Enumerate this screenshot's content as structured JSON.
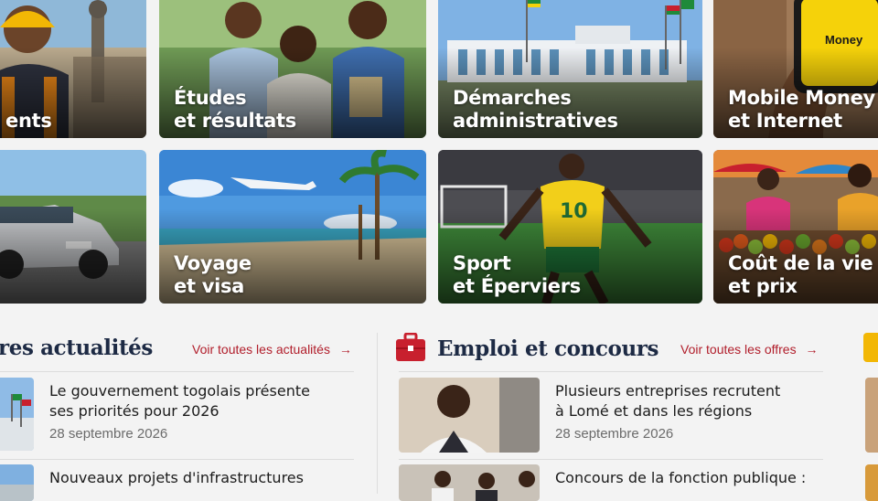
{
  "tiles": [
    {
      "line1": "",
      "line2": "ents"
    },
    {
      "line1": "Études",
      "line2": "et résultats"
    },
    {
      "line1": "Démarches",
      "line2": "administratives"
    },
    {
      "line1": "Mobile Money",
      "line2": "et Internet"
    },
    {
      "line1": "",
      "line2": ""
    },
    {
      "line1": "Voyage",
      "line2": "et visa"
    },
    {
      "line1": "Sport",
      "line2": "et Éperviers"
    },
    {
      "line1": "Coût de la vie",
      "line2": "et prix"
    }
  ],
  "phone_brand": "Money",
  "jersey_number": "10",
  "news": {
    "title": "res actualités",
    "link": "Voir toutes les actualités",
    "items": [
      {
        "line1": "Le gouvernement togolais présente",
        "line2": "ses priorités pour 2026",
        "date": "28 septembre 2026"
      },
      {
        "line1": "Nouveaux projets d'infrastructures",
        "line2": "",
        "date": ""
      }
    ]
  },
  "jobs": {
    "title": "Emploi et concours",
    "link": "Voir toutes les offres",
    "items": [
      {
        "line1": "Plusieurs entreprises recrutent",
        "line2": "à Lomé et dans les régions",
        "date": "28 septembre 2026"
      },
      {
        "line1": "Concours de la fonction publique :",
        "line2": "",
        "date": ""
      }
    ]
  },
  "colors": {
    "accent": "#b11e2b",
    "title": "#1d2a44",
    "jobs_icon": "#c8202e",
    "third_icon": "#f2b705"
  }
}
